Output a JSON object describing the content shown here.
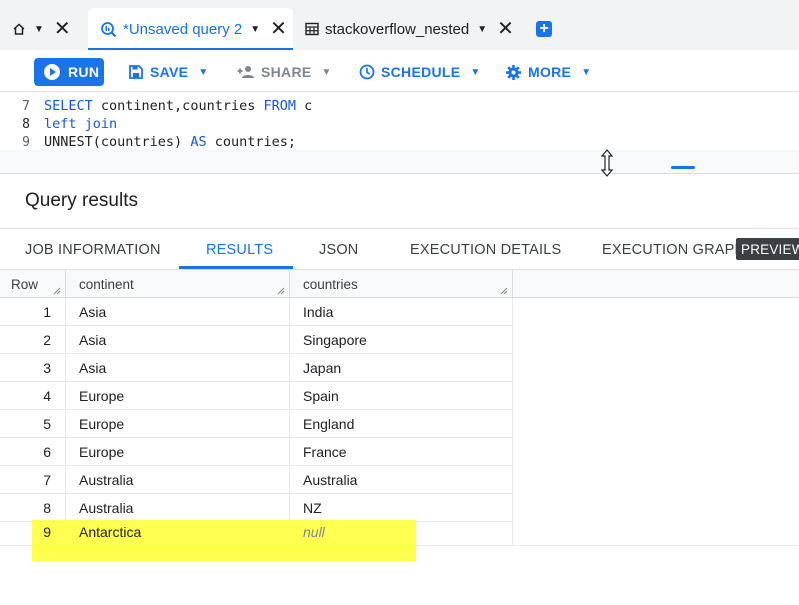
{
  "tabs": [
    {
      "label": "",
      "icon": "home-icon"
    },
    {
      "label": "*Unsaved query 2",
      "icon": "query-icon",
      "active": true
    },
    {
      "label": "stackoverflow_nested",
      "icon": "table-grid-icon"
    }
  ],
  "toolbar": {
    "run": "RUN",
    "save": "SAVE",
    "share": "SHARE",
    "schedule": "SCHEDULE",
    "more": "MORE"
  },
  "editor": {
    "lines": [
      {
        "num": "7",
        "parts": [
          {
            "t": "SELECT",
            "k": true
          },
          {
            "t": " continent,countries ",
            "k": false
          },
          {
            "t": "FROM",
            "k": true
          },
          {
            "t": " c",
            "k": false
          }
        ]
      },
      {
        "num": "8",
        "parts": [
          {
            "t": "left join",
            "k": true
          }
        ]
      },
      {
        "num": "9",
        "parts": [
          {
            "t": "UNNEST(countries) ",
            "k": false
          },
          {
            "t": "AS",
            "k": true
          },
          {
            "t": " countries;",
            "k": false
          }
        ]
      }
    ]
  },
  "results": {
    "title": "Query results",
    "tabs": [
      "JOB INFORMATION",
      "RESULTS",
      "JSON",
      "EXECUTION DETAILS",
      "EXECUTION GRAPH"
    ],
    "active_tab": "RESULTS",
    "badge": "PREVIEW",
    "columns": [
      "Row",
      "continent",
      "countries"
    ],
    "rows": [
      {
        "row": "1",
        "continent": "Asia",
        "countries": "India"
      },
      {
        "row": "2",
        "continent": "Asia",
        "countries": "Singapore"
      },
      {
        "row": "3",
        "continent": "Asia",
        "countries": "Japan"
      },
      {
        "row": "4",
        "continent": "Europe",
        "countries": "Spain"
      },
      {
        "row": "5",
        "continent": "Europe",
        "countries": "England"
      },
      {
        "row": "6",
        "continent": "Europe",
        "countries": "France"
      },
      {
        "row": "7",
        "continent": "Australia",
        "countries": "Australia"
      },
      {
        "row": "8",
        "continent": "Australia",
        "countries": "NZ"
      },
      {
        "row": "9",
        "continent": "Antarctica",
        "countries": "null",
        "is_null": true
      }
    ]
  },
  "colors": {
    "accent": "#1a73e8",
    "highlight": "#ffff33"
  }
}
